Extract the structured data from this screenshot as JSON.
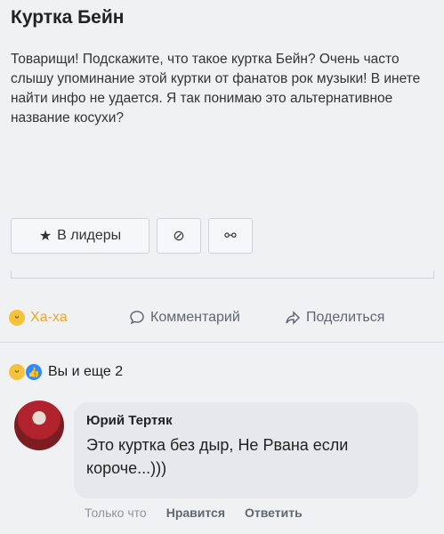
{
  "post": {
    "title": "Куртка Бейн",
    "body": "Товарищи! Подскажите, что такое куртка Бейн? Очень часто слышу упоминание этой куртки от фанатов рок музыки! В инете найти инфо не удается. Я так понимаю это альтернативное название косухи?"
  },
  "post_actions": {
    "leaders_label": "В лидеры",
    "star_icon": "★",
    "block_icon": "⊘",
    "share_icon": "⚯"
  },
  "reactions_bar": {
    "haha_label": "Ха-ха",
    "comment_label": "Комментарий",
    "share_label": "Поделиться"
  },
  "summary": {
    "text": "Вы и еще 2"
  },
  "comment": {
    "author": "Юрий Тертяк",
    "text": "Это куртка без дыр, Не Рвана если короче...)))",
    "time": "Только что",
    "like_label": "Нравится",
    "reply_label": "Ответить"
  }
}
